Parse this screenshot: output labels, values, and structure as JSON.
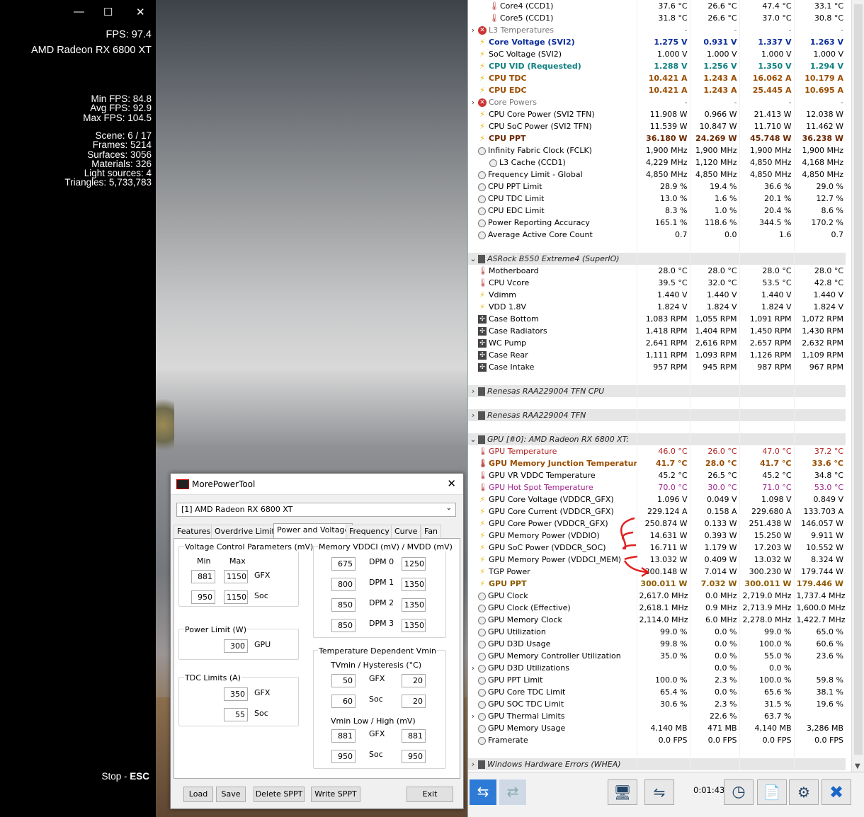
{
  "game": {
    "fps": "FPS: 97.4",
    "gpu": "AMD Radeon RX 6800 XT",
    "stats": [
      "Min FPS: 84.8",
      "Avg FPS: 92.9",
      "Max FPS: 104.5"
    ],
    "scene": [
      "Scene: 6 / 17",
      "Frames: 5214",
      "Surfaces: 3056",
      "Materials: 326",
      "Light sources: 4",
      "Triangles: 5,733,783"
    ],
    "stop": "Stop - ",
    "stop_key": "ESC"
  },
  "hw": {
    "rows": [
      {
        "n": "Core4 (CCD1)",
        "v": [
          "37.6 °C",
          "26.6 °C",
          "47.4 °C",
          "33.1 °C"
        ],
        "ic": "temp",
        "lv": 2,
        "c": ""
      },
      {
        "n": "Core5 (CCD1)",
        "v": [
          "31.8 °C",
          "26.6 °C",
          "37.0 °C",
          "30.8 °C"
        ],
        "ic": "temp",
        "lv": 2,
        "c": ""
      },
      {
        "n": "L3 Temperatures",
        "v": [
          "-",
          "-",
          "-",
          "-"
        ],
        "ic": "err",
        "lv": 1,
        "exp": "›",
        "c": "c-gray"
      },
      {
        "n": "Core Voltage (SVI2)",
        "v": [
          "1.275 V",
          "0.931 V",
          "1.337 V",
          "1.263 V"
        ],
        "ic": "volt",
        "lv": 1,
        "c": "c-blue"
      },
      {
        "n": "SoC Voltage (SVI2)",
        "v": [
          "1.000 V",
          "1.000 V",
          "1.000 V",
          "1.000 V"
        ],
        "ic": "volt",
        "lv": 1,
        "c": ""
      },
      {
        "n": "CPU VID (Requested)",
        "v": [
          "1.288 V",
          "1.256 V",
          "1.350 V",
          "1.294 V"
        ],
        "ic": "volt",
        "lv": 1,
        "c": "c-teal"
      },
      {
        "n": "CPU TDC",
        "v": [
          "10.421 A",
          "1.243 A",
          "16.062 A",
          "10.179 A"
        ],
        "ic": "volt",
        "lv": 1,
        "c": "c-brown"
      },
      {
        "n": "CPU EDC",
        "v": [
          "10.421 A",
          "1.243 A",
          "25.445 A",
          "10.695 A"
        ],
        "ic": "volt",
        "lv": 1,
        "c": "c-brown"
      },
      {
        "n": "Core Powers",
        "v": [
          "-",
          "-",
          "-",
          "-"
        ],
        "ic": "err",
        "lv": 1,
        "exp": "›",
        "c": "c-gray"
      },
      {
        "n": "CPU Core Power (SVI2 TFN)",
        "v": [
          "11.908 W",
          "0.966 W",
          "21.413 W",
          "12.038 W"
        ],
        "ic": "volt",
        "lv": 1,
        "c": ""
      },
      {
        "n": "CPU SoC Power (SVI2 TFN)",
        "v": [
          "11.539 W",
          "10.847 W",
          "11.710 W",
          "11.462 W"
        ],
        "ic": "volt",
        "lv": 1,
        "c": ""
      },
      {
        "n": "CPU PPT",
        "v": [
          "36.180 W",
          "24.269 W",
          "45.748 W",
          "36.238 W"
        ],
        "ic": "volt",
        "lv": 1,
        "c": "c-dk"
      },
      {
        "n": "Infinity Fabric Clock (FCLK)",
        "v": [
          "1,900 MHz",
          "1,900 MHz",
          "1,900 MHz",
          "1,900 MHz"
        ],
        "ic": "clk",
        "lv": 1,
        "c": ""
      },
      {
        "n": "L3 Cache (CCD1)",
        "v": [
          "4,229 MHz",
          "1,120 MHz",
          "4,850 MHz",
          "4,168 MHz"
        ],
        "ic": "clk",
        "lv": 2,
        "c": ""
      },
      {
        "n": "Frequency Limit - Global",
        "v": [
          "4,850 MHz",
          "4,850 MHz",
          "4,850 MHz",
          "4,850 MHz"
        ],
        "ic": "clk",
        "lv": 1,
        "c": ""
      },
      {
        "n": "CPU PPT Limit",
        "v": [
          "28.9 %",
          "19.4 %",
          "36.6 %",
          "29.0 %"
        ],
        "ic": "clk",
        "lv": 1,
        "c": ""
      },
      {
        "n": "CPU TDC Limit",
        "v": [
          "13.0 %",
          "1.6 %",
          "20.1 %",
          "12.7 %"
        ],
        "ic": "clk",
        "lv": 1,
        "c": ""
      },
      {
        "n": "CPU EDC Limit",
        "v": [
          "8.3 %",
          "1.0 %",
          "20.4 %",
          "8.6 %"
        ],
        "ic": "clk",
        "lv": 1,
        "c": ""
      },
      {
        "n": "Power Reporting Accuracy",
        "v": [
          "165.1 %",
          "118.6 %",
          "344.5 %",
          "170.2 %"
        ],
        "ic": "clk",
        "lv": 1,
        "c": ""
      },
      {
        "n": "Average Active Core Count",
        "v": [
          "0.7",
          "0.0",
          "1.6",
          "0.7"
        ],
        "ic": "clk",
        "lv": 1,
        "c": ""
      },
      {
        "blank": true
      },
      {
        "n": "ASRock B550 Extreme4 (SuperIO)",
        "grp": true,
        "exp": "⌄"
      },
      {
        "n": "Motherboard",
        "v": [
          "28.0 °C",
          "28.0 °C",
          "28.0 °C",
          "28.0 °C"
        ],
        "ic": "temp",
        "lv": 1,
        "c": ""
      },
      {
        "n": "CPU Vcore",
        "v": [
          "39.5 °C",
          "32.0 °C",
          "53.5 °C",
          "42.8 °C"
        ],
        "ic": "temp",
        "lv": 1,
        "c": ""
      },
      {
        "n": "Vdimm",
        "v": [
          "1.440 V",
          "1.440 V",
          "1.440 V",
          "1.440 V"
        ],
        "ic": "volt",
        "lv": 1,
        "c": ""
      },
      {
        "n": "VDD 1.8V",
        "v": [
          "1.824 V",
          "1.824 V",
          "1.824 V",
          "1.824 V"
        ],
        "ic": "volt",
        "lv": 1,
        "c": ""
      },
      {
        "n": "Case Bottom",
        "v": [
          "1,083 RPM",
          "1,055 RPM",
          "1,091 RPM",
          "1,072 RPM"
        ],
        "ic": "fan",
        "lv": 1,
        "c": ""
      },
      {
        "n": "Case Radiators",
        "v": [
          "1,418 RPM",
          "1,404 RPM",
          "1,450 RPM",
          "1,430 RPM"
        ],
        "ic": "fan",
        "lv": 1,
        "c": ""
      },
      {
        "n": "WC Pump",
        "v": [
          "2,641 RPM",
          "2,616 RPM",
          "2,657 RPM",
          "2,632 RPM"
        ],
        "ic": "fan",
        "lv": 1,
        "c": ""
      },
      {
        "n": "Case Rear",
        "v": [
          "1,111 RPM",
          "1,093 RPM",
          "1,126 RPM",
          "1,109 RPM"
        ],
        "ic": "fan",
        "lv": 1,
        "c": ""
      },
      {
        "n": "Case Intake",
        "v": [
          "957 RPM",
          "945 RPM",
          "987 RPM",
          "967 RPM"
        ],
        "ic": "fan",
        "lv": 1,
        "c": ""
      },
      {
        "blank": true
      },
      {
        "n": "Renesas RAA229004 TFN CPU",
        "grp": true,
        "exp": "›"
      },
      {
        "blank": true
      },
      {
        "n": "Renesas RAA229004 TFN",
        "grp": true,
        "exp": "›"
      },
      {
        "blank": true
      },
      {
        "n": "GPU [#0]: AMD Radeon RX 6800 XT:",
        "grp": true,
        "exp": "⌄"
      },
      {
        "n": "GPU Temperature",
        "v": [
          "46.0 °C",
          "26.0 °C",
          "47.0 °C",
          "37.2 °C"
        ],
        "ic": "temp",
        "lv": 1,
        "c": "c-red"
      },
      {
        "n": "GPU Memory Junction Temperature",
        "v": [
          "41.7 °C",
          "28.0 °C",
          "41.7 °C",
          "33.6 °C"
        ],
        "ic": "temp",
        "lv": 1,
        "c": "c-brown"
      },
      {
        "n": "GPU VR VDDC Temperature",
        "v": [
          "45.2 °C",
          "26.5 °C",
          "45.2 °C",
          "34.8 °C"
        ],
        "ic": "temp",
        "lv": 1,
        "c": ""
      },
      {
        "n": "GPU Hot Spot Temperature",
        "v": [
          "70.0 °C",
          "30.0 °C",
          "71.0 °C",
          "53.0 °C"
        ],
        "ic": "temp",
        "lv": 1,
        "c": "c-pink"
      },
      {
        "n": "GPU Core Voltage (VDDCR_GFX)",
        "v": [
          "1.096 V",
          "0.049 V",
          "1.098 V",
          "0.849 V"
        ],
        "ic": "volt",
        "lv": 1,
        "c": ""
      },
      {
        "n": "GPU Core Current (VDDCR_GFX)",
        "v": [
          "229.124 A",
          "0.158 A",
          "229.680 A",
          "133.703 A"
        ],
        "ic": "volt",
        "lv": 1,
        "c": ""
      },
      {
        "n": "GPU Core Power (VDDCR_GFX)",
        "v": [
          "250.874 W",
          "0.133 W",
          "251.438 W",
          "146.057 W"
        ],
        "ic": "volt",
        "lv": 1,
        "c": ""
      },
      {
        "n": "GPU Memory Power (VDDIO)",
        "v": [
          "14.631 W",
          "0.393 W",
          "15.250 W",
          "9.911 W"
        ],
        "ic": "volt",
        "lv": 1,
        "c": ""
      },
      {
        "n": "GPU SoC Power (VDDCR_SOC)",
        "v": [
          "16.711 W",
          "1.179 W",
          "17.203 W",
          "10.552 W"
        ],
        "ic": "volt",
        "lv": 1,
        "c": ""
      },
      {
        "n": "GPU Memory Power (VDDCI_MEM)",
        "v": [
          "13.032 W",
          "0.409 W",
          "13.032 W",
          "8.324 W"
        ],
        "ic": "volt",
        "lv": 1,
        "c": ""
      },
      {
        "n": "TGP Power",
        "v": [
          "300.148 W",
          "7.014 W",
          "300.230 W",
          "179.744 W"
        ],
        "ic": "volt",
        "lv": 1,
        "c": ""
      },
      {
        "n": "GPU PPT",
        "v": [
          "300.011 W",
          "7.032 W",
          "300.011 W",
          "179.446 W"
        ],
        "ic": "volt",
        "lv": 1,
        "c": "c-gpu"
      },
      {
        "n": "GPU Clock",
        "v": [
          "2,617.0 MHz",
          "0.0 MHz",
          "2,719.0 MHz",
          "1,737.4 MHz"
        ],
        "ic": "clk",
        "lv": 1,
        "c": ""
      },
      {
        "n": "GPU Clock (Effective)",
        "v": [
          "2,618.1 MHz",
          "0.9 MHz",
          "2,713.9 MHz",
          "1,600.0 MHz"
        ],
        "ic": "clk",
        "lv": 1,
        "c": ""
      },
      {
        "n": "GPU Memory Clock",
        "v": [
          "2,114.0 MHz",
          "6.0 MHz",
          "2,278.0 MHz",
          "1,422.7 MHz"
        ],
        "ic": "clk",
        "lv": 1,
        "c": ""
      },
      {
        "n": "GPU Utilization",
        "v": [
          "99.0 %",
          "0.0 %",
          "99.0 %",
          "65.0 %"
        ],
        "ic": "clk",
        "lv": 1,
        "c": ""
      },
      {
        "n": "GPU D3D Usage",
        "v": [
          "99.8 %",
          "0.0 %",
          "100.0 %",
          "60.6 %"
        ],
        "ic": "clk",
        "lv": 1,
        "c": ""
      },
      {
        "n": "GPU Memory Controller Utilization",
        "v": [
          "35.0 %",
          "0.0 %",
          "55.0 %",
          "23.6 %"
        ],
        "ic": "clk",
        "lv": 1,
        "c": ""
      },
      {
        "n": "GPU D3D Utilizations",
        "v": [
          "",
          "0.0 %",
          "0.0 %",
          ""
        ],
        "ic": "clk",
        "lv": 1,
        "exp": "›",
        "c": ""
      },
      {
        "n": "GPU PPT Limit",
        "v": [
          "100.0 %",
          "2.3 %",
          "100.0 %",
          "59.8 %"
        ],
        "ic": "clk",
        "lv": 1,
        "c": ""
      },
      {
        "n": "GPU Core TDC Limit",
        "v": [
          "65.4 %",
          "0.0 %",
          "65.6 %",
          "38.1 %"
        ],
        "ic": "clk",
        "lv": 1,
        "c": ""
      },
      {
        "n": "GPU SOC TDC Limit",
        "v": [
          "30.6 %",
          "2.3 %",
          "31.5 %",
          "19.6 %"
        ],
        "ic": "clk",
        "lv": 1,
        "c": ""
      },
      {
        "n": "GPU Thermal Limits",
        "v": [
          "",
          "22.6 %",
          "63.7 %",
          ""
        ],
        "ic": "clk",
        "lv": 1,
        "exp": "›",
        "c": ""
      },
      {
        "n": "GPU Memory Usage",
        "v": [
          "4,140 MB",
          "471 MB",
          "4,140 MB",
          "3,286 MB"
        ],
        "ic": "clk",
        "lv": 1,
        "c": ""
      },
      {
        "n": "Framerate",
        "v": [
          "0.0 FPS",
          "0.0 FPS",
          "0.0 FPS",
          "0.0 FPS"
        ],
        "ic": "clk",
        "lv": 1,
        "c": ""
      },
      {
        "blank": true
      },
      {
        "n": "Windows Hardware Errors (WHEA)",
        "grp": true,
        "exp": "›"
      }
    ],
    "timer": "0:01:43"
  },
  "mpt": {
    "title": "MorePowerTool",
    "gpu_select": "[1] AMD Radeon RX 6800 XT",
    "tabs": [
      "Features",
      "Overdrive Limits",
      "Power and Voltage",
      "Frequency",
      "Curve",
      "Fan"
    ],
    "vcp": {
      "legend": "Voltage Control Parameters (mV)",
      "min": "Min",
      "max": "Max",
      "gfx": "GFX",
      "soc": "Soc",
      "gfx_min": "881",
      "gfx_max": "1150",
      "soc_min": "950",
      "soc_max": "1150"
    },
    "pl": {
      "legend": "Power Limit (W)",
      "val": "300",
      "lbl": "GPU"
    },
    "tdc": {
      "legend": "TDC Limits (A)",
      "gfx": "350",
      "soc": "55",
      "gfx_lbl": "GFX",
      "soc_lbl": "Soc"
    },
    "mem": {
      "legend": "Memory VDDCI (mV) / MVDD (mV)",
      "rows": [
        {
          "l": "675",
          "lbl": "DPM 0",
          "r": "1250"
        },
        {
          "l": "800",
          "lbl": "DPM 1",
          "r": "1350"
        },
        {
          "l": "850",
          "lbl": "DPM 2",
          "r": "1350"
        },
        {
          "l": "850",
          "lbl": "DPM 3",
          "r": "1350"
        }
      ]
    },
    "tdv": {
      "legend": "Temperature Dependent Vmin",
      "sub1": "TVmin / Hysteresis (°C)",
      "gfx_a": "50",
      "gfx_b": "20",
      "soc_a": "60",
      "soc_b": "20",
      "sub2": "Vmin Low / High (mV)",
      "gfx_c": "881",
      "gfx_d": "881",
      "soc_c": "950",
      "soc_d": "950",
      "gfx": "GFX",
      "soc": "Soc"
    },
    "buttons": {
      "load": "Load",
      "save": "Save",
      "delete": "Delete SPPT",
      "write": "Write SPPT",
      "exit": "Exit"
    }
  }
}
